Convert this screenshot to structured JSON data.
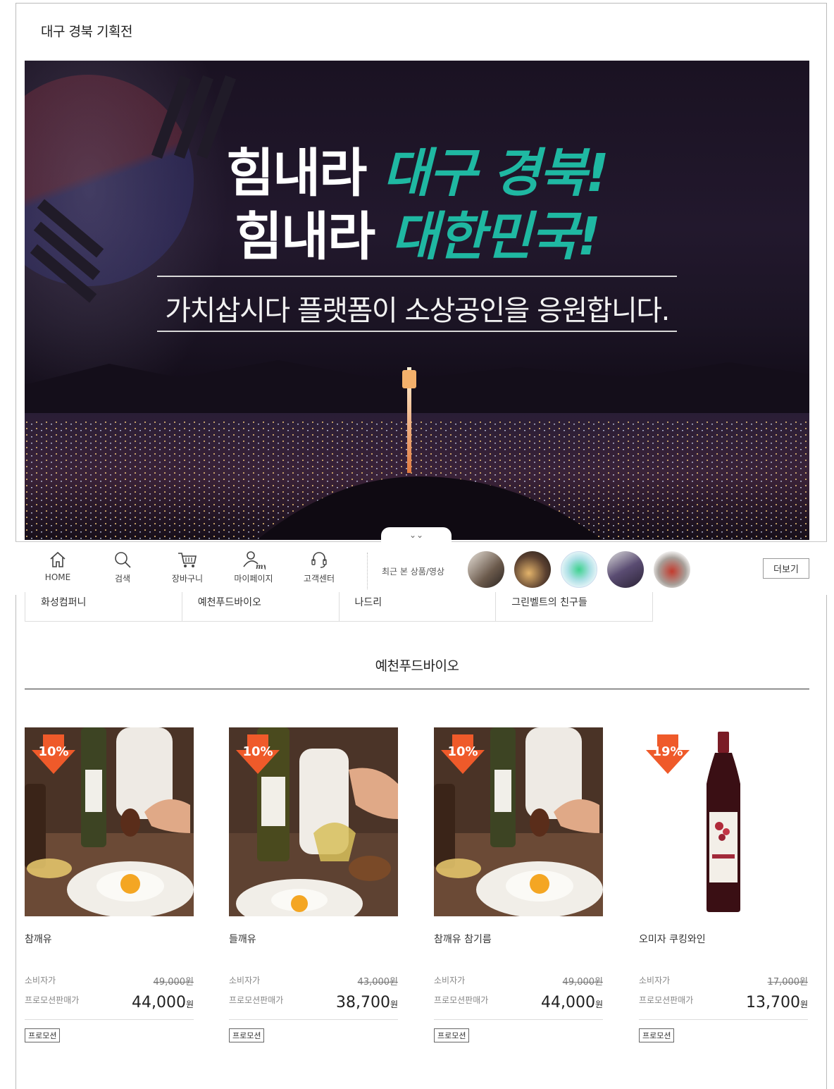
{
  "page": {
    "title": "대구 경북 기획전"
  },
  "banner": {
    "line1_white": "힘내라 ",
    "line1_teal": "대구 경북!",
    "line2_white": "힘내라 ",
    "line2_teal": "대한민국!",
    "subtitle": "가치삽시다 플랫폼이 소상공인을 응원합니다.",
    "accent_color": "#1fb8a2"
  },
  "quickbar": {
    "toggle_icon": "chevron-double-down-icon",
    "items": [
      {
        "label": "HOME",
        "icon": "home-icon"
      },
      {
        "label": "검색",
        "icon": "search-icon"
      },
      {
        "label": "장바구니",
        "icon": "cart-icon"
      },
      {
        "label": "마이페이지",
        "icon": "user-my-icon"
      },
      {
        "label": "고객센터",
        "icon": "headset-icon"
      }
    ],
    "recent_label": "최근 본 상품/영상",
    "more_label": "더보기"
  },
  "stores": [
    {
      "name": "화성컴퍼니"
    },
    {
      "name": "예천푸드바이오"
    },
    {
      "name": "나드리"
    },
    {
      "name": "그린벨트의 친구들"
    }
  ],
  "section": {
    "title": "예천푸드바이오"
  },
  "products": [
    {
      "discount": "10%",
      "name": "참깨유",
      "list_label": "소비자가",
      "list_price": "49,000원",
      "sale_label": "프로모션판매가",
      "sale_price": "44,000",
      "won": "원",
      "tag": "프로모션"
    },
    {
      "discount": "10%",
      "name": "들깨유",
      "list_label": "소비자가",
      "list_price": "43,000원",
      "sale_label": "프로모션판매가",
      "sale_price": "38,700",
      "won": "원",
      "tag": "프로모션"
    },
    {
      "discount": "10%",
      "name": "참깨유 참기름",
      "list_label": "소비자가",
      "list_price": "49,000원",
      "sale_label": "프로모션판매가",
      "sale_price": "44,000",
      "won": "원",
      "tag": "프로모션"
    },
    {
      "discount": "19%",
      "name": "오미자 쿠킹와인",
      "list_label": "소비자가",
      "list_price": "17,000원",
      "sale_label": "프로모션판매가",
      "sale_price": "13,700",
      "won": "원",
      "tag": "프로모션"
    }
  ]
}
